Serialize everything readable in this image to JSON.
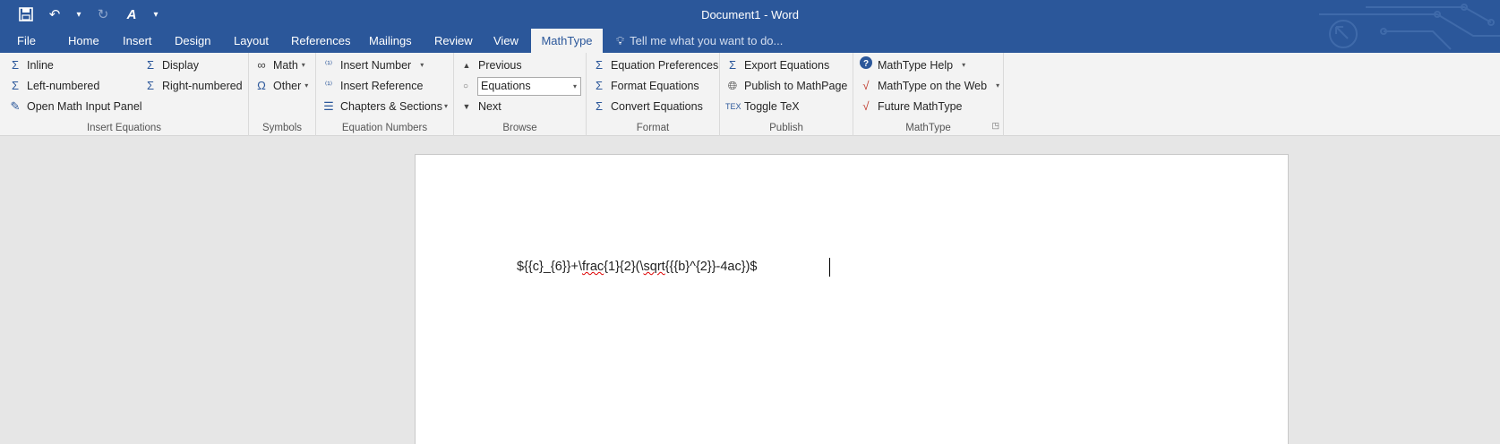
{
  "window": {
    "title": "Document1 - Word"
  },
  "qat": {
    "items": [
      {
        "name": "save-icon",
        "glyph": "🖫"
      },
      {
        "name": "undo-icon",
        "glyph": "↶"
      },
      {
        "name": "undo-dropdown-icon",
        "glyph": "▾"
      },
      {
        "name": "redo-icon",
        "glyph": "↻"
      },
      {
        "name": "spelling-icon",
        "glyph": "A"
      },
      {
        "name": "customize-qat-icon",
        "glyph": "⌄"
      }
    ]
  },
  "tabs": [
    "File",
    "Home",
    "Insert",
    "Design",
    "Layout",
    "References",
    "Mailings",
    "Review",
    "View",
    "MathType"
  ],
  "active_tab": "MathType",
  "tell_me": {
    "placeholder": "Tell me what you want to do..."
  },
  "ribbon": {
    "insert_equations": {
      "label": "Insert Equations",
      "inline": "Inline",
      "left_numbered": "Left-numbered",
      "open_math_input_panel": "Open Math Input Panel",
      "display": "Display",
      "right_numbered": "Right-numbered"
    },
    "symbols": {
      "label": "Symbols",
      "math": "Math",
      "other": "Other"
    },
    "equation_numbers": {
      "label": "Equation Numbers",
      "insert_number": "Insert Number",
      "insert_reference": "Insert Reference",
      "chapters_sections": "Chapters & Sections"
    },
    "browse": {
      "label": "Browse",
      "previous": "Previous",
      "combo_value": "Equations",
      "next": "Next"
    },
    "format": {
      "label": "Format",
      "equation_preferences": "Equation Preferences",
      "format_equations": "Format Equations",
      "convert_equations": "Convert Equations"
    },
    "publish": {
      "label": "Publish",
      "export_equations": "Export Equations",
      "publish_to_mathpage": "Publish to MathPage",
      "toggle_tex": "Toggle TeX"
    },
    "mathtype": {
      "label": "MathType",
      "help": "MathType Help",
      "on_the_web": "MathType on the Web",
      "future": "Future MathType"
    }
  },
  "document": {
    "text_parts": [
      "${{c}_{6}}+\\",
      "frac",
      "{1}{2}(\\",
      "sqrt",
      "{{{b}^{2}}-4ac})$"
    ]
  },
  "colors": {
    "accent": "#2b579a",
    "ribbon_bg": "#f3f3f3",
    "canvas_bg": "#e6e6e6"
  }
}
